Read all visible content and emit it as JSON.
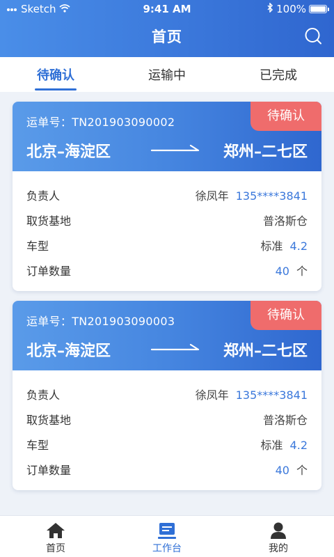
{
  "status_bar": {
    "carrier": "Sketch",
    "time": "9:41 AM",
    "battery": "100%"
  },
  "header": {
    "title": "首页"
  },
  "tabs": [
    {
      "label": "待确认"
    },
    {
      "label": "运输中"
    },
    {
      "label": "已完成"
    }
  ],
  "orders": [
    {
      "waybill": "运单号：TN201903090002",
      "badge": "待确认",
      "from": "北京–海淀区",
      "to": "郑州–二七区",
      "person_label": "负责人",
      "person_name": "徐凤年",
      "person_phone": "135****3841",
      "pickup_label": "取货基地",
      "pickup_value": "普洛斯仓",
      "vehicle_label": "车型",
      "vehicle_type": "标准",
      "vehicle_size": "4.2",
      "qty_label": "订单数量",
      "qty_value": "40",
      "qty_unit": "个"
    },
    {
      "waybill": "运单号：TN201903090003",
      "badge": "待确认",
      "from": "北京–海淀区",
      "to": "郑州–二七区",
      "person_label": "负责人",
      "person_name": "徐凤年",
      "person_phone": "135****3841",
      "pickup_label": "取货基地",
      "pickup_value": "普洛斯仓",
      "vehicle_label": "车型",
      "vehicle_type": "标准",
      "vehicle_size": "4.2",
      "qty_label": "订单数量",
      "qty_value": "40",
      "qty_unit": "个"
    }
  ],
  "tabbar": [
    {
      "label": "首页",
      "icon": "home-icon"
    },
    {
      "label": "工作台",
      "icon": "workbench-icon"
    },
    {
      "label": "我的",
      "icon": "user-icon"
    }
  ],
  "colors": {
    "primary": "#2f6fd6",
    "badge": "#ef6c6c"
  }
}
